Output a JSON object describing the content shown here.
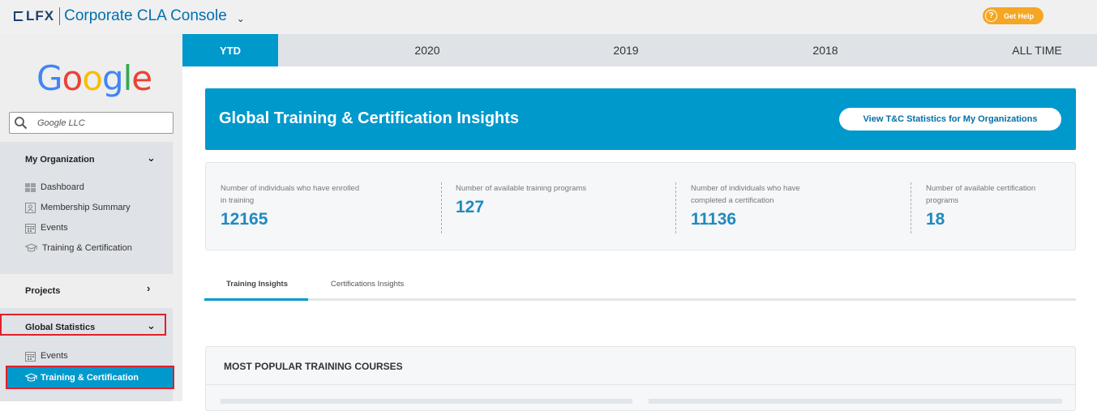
{
  "header": {
    "logo_text": "LFX",
    "app_title": "Corporate CLA Console",
    "help_label": "Get Help",
    "help_icon": "question-circle-icon"
  },
  "sidebar": {
    "company_logo_text": "Google",
    "search_value": "Google LLC",
    "my_org": {
      "title": "My Organization",
      "items": [
        {
          "label": "Dashboard",
          "icon": "grid-icon"
        },
        {
          "label": "Membership Summary",
          "icon": "id-card-icon"
        },
        {
          "label": "Events",
          "icon": "calendar-icon"
        },
        {
          "label": "Training & Certification",
          "icon": "graduation-cap-icon"
        }
      ]
    },
    "projects": {
      "title": "Projects"
    },
    "global_stats": {
      "title": "Global Statistics",
      "items": [
        {
          "label": "Events",
          "icon": "calendar-icon"
        },
        {
          "label": "Training & Certification",
          "icon": "graduation-cap-icon",
          "active": true
        }
      ]
    }
  },
  "year_tabs": [
    "YTD",
    "2020",
    "2019",
    "2018",
    "ALL TIME"
  ],
  "banner": {
    "title": "Global Training & Certification Insights",
    "button_label": "View T&C Statistics for My Organizations"
  },
  "stats": [
    {
      "label": "Number of individuals who have enrolled in training",
      "value": "12165"
    },
    {
      "label": "Number of available training programs",
      "value": "127"
    },
    {
      "label": "Number of individuals who have completed a certification",
      "value": "11136"
    },
    {
      "label": "Number of available certification programs",
      "value": "18"
    }
  ],
  "insight_tabs": [
    "Training Insights",
    "Certifications Insights"
  ],
  "courses": {
    "title": "MOST POPULAR TRAINING COURSES"
  },
  "colors": {
    "accent": "#0099cc",
    "help": "#f5a623",
    "highlight": "#e0202a"
  }
}
